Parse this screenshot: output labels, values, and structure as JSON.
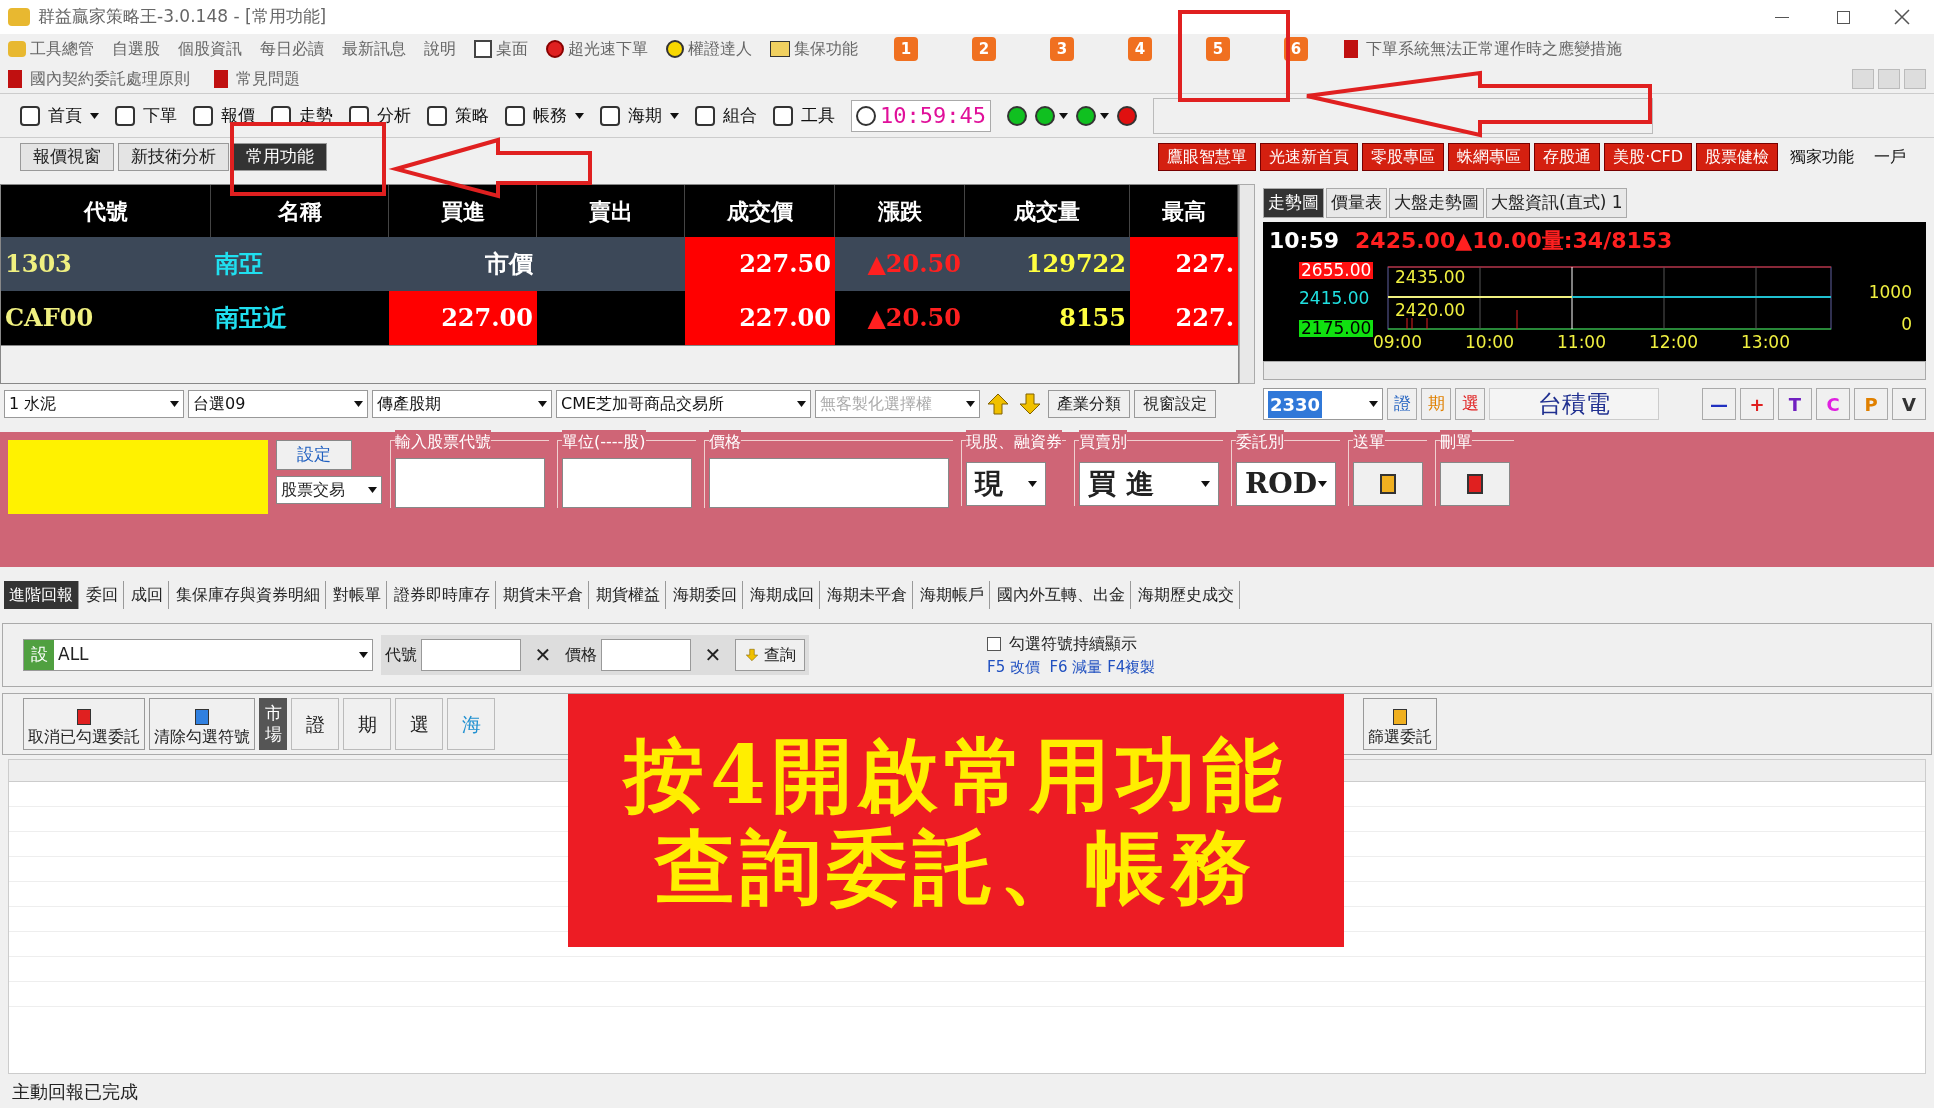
{
  "window": {
    "title": "群益贏家策略王-3.0.148 - [常用功能]"
  },
  "menu": {
    "items": [
      "工具總管",
      "自選股",
      "個股資訊",
      "每日必讀",
      "最新訊息",
      "說明",
      "桌面",
      "超光速下單",
      "權證達人",
      "集保功能"
    ],
    "number_buttons": [
      "1",
      "2",
      "3",
      "4",
      "5",
      "6"
    ],
    "notice": "下單系統無法正常運作時之應變措施",
    "row2": [
      "國內契約委託處理原則",
      "常見問題"
    ]
  },
  "toolbar": {
    "items": [
      {
        "kind": "button",
        "label": "首頁"
      },
      {
        "kind": "dropdown"
      },
      {
        "kind": "button",
        "label": "下單"
      },
      {
        "kind": "button",
        "label": "報價"
      },
      {
        "kind": "button",
        "label": "走勢"
      },
      {
        "kind": "button",
        "label": "分析"
      },
      {
        "kind": "button",
        "label": "策略"
      },
      {
        "kind": "button",
        "label": "帳務"
      },
      {
        "kind": "dropdown"
      },
      {
        "kind": "button",
        "label": "海期"
      },
      {
        "kind": "dropdown"
      },
      {
        "kind": "button",
        "label": "組合"
      },
      {
        "kind": "button",
        "label": "工具"
      }
    ],
    "clock": "10:59:45",
    "lights": [
      {
        "kind": "light",
        "color": "#10c020"
      },
      {
        "kind": "light",
        "color": "#10c020"
      },
      {
        "kind": "dropdown"
      },
      {
        "kind": "light",
        "color": "#10c020"
      },
      {
        "kind": "dropdown"
      },
      {
        "kind": "light",
        "color": "#e01010"
      }
    ]
  },
  "view_tabs": [
    {
      "label": "報價視窗",
      "selected": false
    },
    {
      "label": "新技術分析",
      "selected": false
    },
    {
      "label": "常用功能",
      "selected": true
    }
  ],
  "quick_buttons": [
    {
      "label": "鷹眼智慧單",
      "kind": "red"
    },
    {
      "label": "光速新首頁",
      "kind": "red"
    },
    {
      "label": "零股專區",
      "kind": "red"
    },
    {
      "label": "蛛網專區",
      "kind": "red"
    },
    {
      "label": "存股通",
      "kind": "red"
    },
    {
      "label": "美股‧CFD",
      "kind": "red"
    },
    {
      "label": "股票健檢",
      "kind": "red"
    },
    {
      "label": "獨家功能",
      "kind": "plain"
    },
    {
      "label": "一戶",
      "kind": "plain"
    }
  ],
  "quote_table": {
    "columns": [
      "代號",
      "名稱",
      "買進",
      "賣出",
      "成交價",
      "漲跌",
      "成交量",
      "最高"
    ],
    "rows": [
      {
        "selected": true,
        "cells": [
          {
            "text": "1303",
            "highlight": false
          },
          {
            "text": "南亞",
            "highlight": false
          },
          {
            "text": "市價",
            "highlight": false
          },
          null,
          {
            "text": "227.50",
            "highlight": true
          },
          {
            "text": "▲20.50",
            "highlight": false
          },
          {
            "text": "129722",
            "highlight": false
          },
          {
            "text": "227.",
            "highlight": true
          }
        ]
      },
      {
        "selected": false,
        "cells": [
          {
            "text": "CAF00",
            "highlight": false
          },
          {
            "text": "南亞近",
            "highlight": false
          },
          {
            "text": "227.00",
            "highlight": true
          },
          null,
          {
            "text": "227.00",
            "highlight": true
          },
          {
            "text": "▲20.50",
            "highlight": false
          },
          {
            "text": "8155",
            "highlight": false
          },
          {
            "text": "227.",
            "highlight": true
          }
        ]
      }
    ]
  },
  "filters": {
    "combos": [
      {
        "value": "1 水泥",
        "disabled": false
      },
      {
        "value": "台選09",
        "disabled": false
      },
      {
        "value": "傳產股期",
        "disabled": false
      },
      {
        "value": "CME芝加哥商品交易所",
        "disabled": false
      },
      {
        "value": "無客製化選擇權",
        "disabled": true
      }
    ],
    "buttons": [
      "產業分類",
      "視窗設定"
    ]
  },
  "chart_panel": {
    "tabs": [
      {
        "label": "走勢圖",
        "selected": true
      },
      {
        "label": "價量表",
        "selected": false
      },
      {
        "label": "大盤走勢圖",
        "selected": false
      },
      {
        "label": "大盤資訊(直式) 1",
        "selected": false
      }
    ],
    "time": "10:59",
    "quote": "2425.00▲10.00量:34/8153",
    "price_high": "2655.00",
    "price_ref": "2415.00",
    "price_low": "2175.00",
    "inner_labels": [
      "2435.00",
      "2420.00"
    ],
    "volume_labels": [
      "1000",
      "0"
    ],
    "time_labels": [
      "09:00",
      "10:00",
      "11:00",
      "12:00",
      "13:00"
    ],
    "stock_code": "2330",
    "market_buttons": [
      "證",
      "期",
      "選"
    ],
    "stock_name": "台積電",
    "op_buttons": [
      "—",
      "+",
      "T",
      "C",
      "P",
      "V"
    ]
  },
  "order_panel": {
    "settings_button": "設定",
    "trade_type": "股票交易",
    "stock_code_label": "輸入股票代號",
    "unit_label": "單位(----股)",
    "price_label": "價格",
    "cash_label": "現股、融資券",
    "cash_value": "現",
    "side_label": "買賣別",
    "side_value": "買 進",
    "order_type_label": "委託別",
    "order_type_value": "ROD",
    "send_label": "送單",
    "delete_label": "刪單"
  },
  "report_tabs": [
    {
      "label": "進階回報",
      "selected": true
    },
    {
      "label": "委回",
      "selected": false
    },
    {
      "label": "成回",
      "selected": false
    },
    {
      "label": "集保庫存與資券明細",
      "selected": false
    },
    {
      "label": "對帳單",
      "selected": false
    },
    {
      "label": "證券即時庫存",
      "selected": false
    },
    {
      "label": "期貨未平倉",
      "selected": false
    },
    {
      "label": "期貨權益",
      "selected": false
    },
    {
      "label": "海期委回",
      "selected": false
    },
    {
      "label": "海期成回",
      "selected": false
    },
    {
      "label": "海期未平倉",
      "selected": false
    },
    {
      "label": "海期帳戶",
      "selected": false
    },
    {
      "label": "國內外互轉、出金",
      "selected": false
    },
    {
      "label": "海期歷史成交",
      "selected": false
    }
  ],
  "query": {
    "settings_badge": "設",
    "filter": "ALL",
    "code_label": "代號",
    "clear": "✕",
    "price_label": "價格",
    "query_button": "查詢",
    "keep_marks": {
      "label": "勾選符號持續顯示",
      "checked": false
    },
    "hint": "F5 改價  F6 減量 F4複製"
  },
  "actions": {
    "cancel_checked": "取消已勾選委託",
    "clear_marks": "清除勾選符號",
    "market_label": "市場",
    "markets": [
      {
        "label": "證",
        "selected": false
      },
      {
        "label": "期",
        "selected": false
      },
      {
        "label": "選",
        "selected": false
      },
      {
        "label": "海",
        "selected": false
      }
    ],
    "filter_orders": "篩選委託"
  },
  "status_bar": "主動回報已完成",
  "banner": [
    "按4開啟常用功能",
    "查詢委託、帳務"
  ]
}
